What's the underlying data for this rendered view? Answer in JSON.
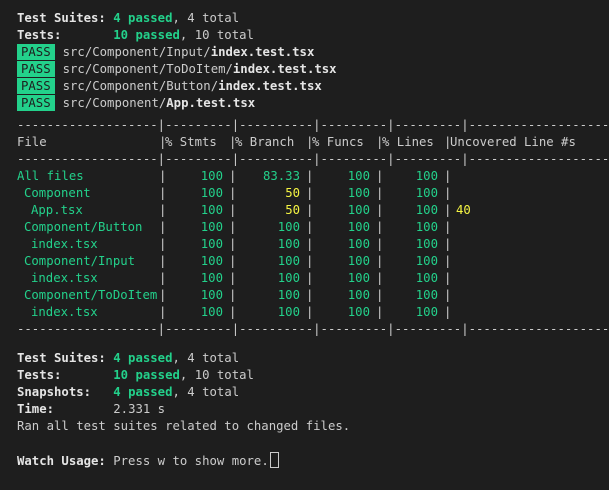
{
  "summary_top": {
    "suites_label": "Test Suites:",
    "suites_passed": "4 passed",
    "suites_total": ", 4 total",
    "tests_label": "Tests:",
    "tests_passed": "10 passed",
    "tests_total": ", 10 total"
  },
  "pass_lines": [
    {
      "badge": "PASS",
      "dir": "src/Component/Input/",
      "file": "index.test.tsx"
    },
    {
      "badge": "PASS",
      "dir": "src/Component/ToDoItem/",
      "file": "index.test.tsx"
    },
    {
      "badge": "PASS",
      "dir": "src/Component/Button/",
      "file": "index.test.tsx"
    },
    {
      "badge": "PASS",
      "dir": "src/Component/",
      "file": "App.test.tsx"
    }
  ],
  "coverage": {
    "dash_line": "-------------------|---------|----------|---------|---------|-------------------",
    "headers": [
      "File",
      "% Stmts",
      "% Branch",
      "% Funcs",
      "% Lines",
      "Uncovered Line #s"
    ],
    "rows": [
      {
        "file": "All files",
        "indent": 0,
        "stmts": "100",
        "branch": "83.33",
        "funcs": "100",
        "lines": "100",
        "uncovered": "",
        "branch_warn": false
      },
      {
        "file": "Component",
        "indent": 1,
        "stmts": "100",
        "branch": "50",
        "funcs": "100",
        "lines": "100",
        "uncovered": "",
        "branch_warn": true
      },
      {
        "file": "App.tsx",
        "indent": 2,
        "stmts": "100",
        "branch": "50",
        "funcs": "100",
        "lines": "100",
        "uncovered": "40",
        "branch_warn": true
      },
      {
        "file": "Component/Button",
        "indent": 1,
        "stmts": "100",
        "branch": "100",
        "funcs": "100",
        "lines": "100",
        "uncovered": "",
        "branch_warn": false
      },
      {
        "file": "index.tsx",
        "indent": 2,
        "stmts": "100",
        "branch": "100",
        "funcs": "100",
        "lines": "100",
        "uncovered": "",
        "branch_warn": false
      },
      {
        "file": "Component/Input",
        "indent": 1,
        "stmts": "100",
        "branch": "100",
        "funcs": "100",
        "lines": "100",
        "uncovered": "",
        "branch_warn": false
      },
      {
        "file": "index.tsx",
        "indent": 2,
        "stmts": "100",
        "branch": "100",
        "funcs": "100",
        "lines": "100",
        "uncovered": "",
        "branch_warn": false
      },
      {
        "file": "Component/ToDoItem",
        "indent": 1,
        "stmts": "100",
        "branch": "100",
        "funcs": "100",
        "lines": "100",
        "uncovered": "",
        "branch_warn": false
      },
      {
        "file": "index.tsx",
        "indent": 2,
        "stmts": "100",
        "branch": "100",
        "funcs": "100",
        "lines": "100",
        "uncovered": "",
        "branch_warn": false
      }
    ]
  },
  "summary_bottom": {
    "suites_label": "Test Suites:",
    "suites_passed": "4 passed",
    "suites_total": ", 4 total",
    "tests_label": "Tests:",
    "tests_passed": "10 passed",
    "tests_total": ", 10 total",
    "snap_label": "Snapshots:",
    "snap_passed": "4 passed",
    "snap_total": ", 4 total",
    "time_label": "Time:",
    "time_value": "2.331 s",
    "ran_text": "Ran all test suites related to changed files."
  },
  "watch": {
    "label": "Watch Usage:",
    "text": " Press w to show more."
  },
  "colors": {
    "background": "#1e1e1e",
    "text": "#cccccc",
    "pass": "#23d18b",
    "warn": "#f5f543"
  }
}
